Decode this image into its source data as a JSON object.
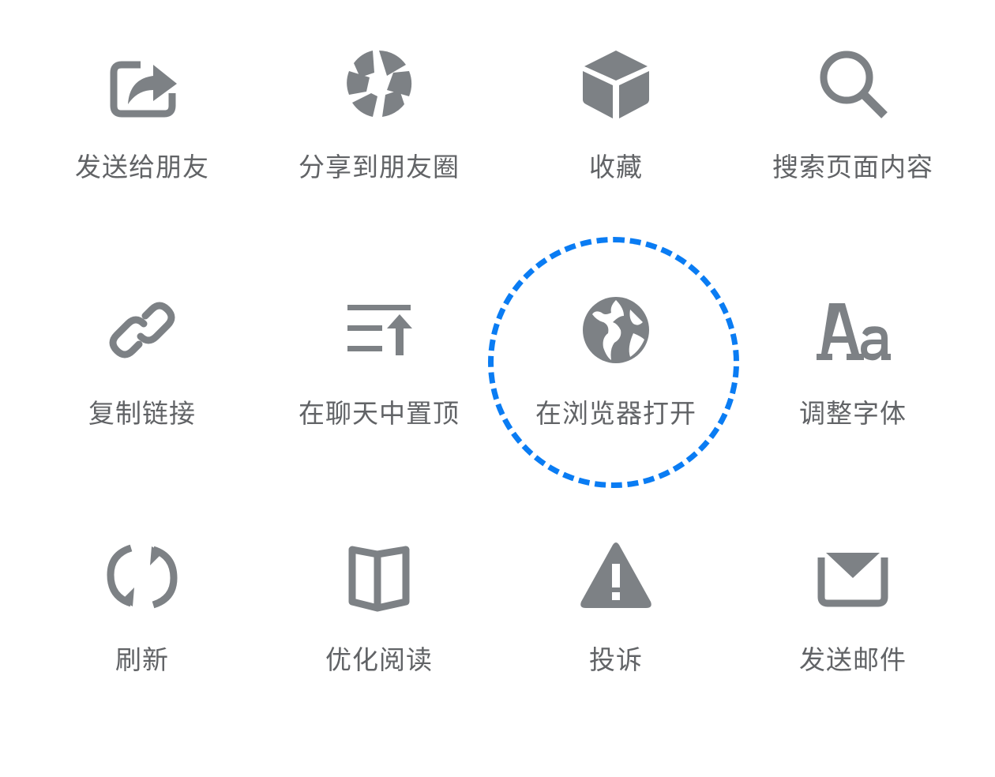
{
  "menu": {
    "items": [
      {
        "label": "发送给朋友",
        "icon": "share-forward-icon"
      },
      {
        "label": "分享到朋友圈",
        "icon": "moments-shutter-icon"
      },
      {
        "label": "收藏",
        "icon": "favorite-cube-icon"
      },
      {
        "label": "搜索页面内容",
        "icon": "search-icon"
      },
      {
        "label": "复制链接",
        "icon": "link-icon"
      },
      {
        "label": "在聊天中置顶",
        "icon": "pin-to-top-icon"
      },
      {
        "label": "在浏览器打开",
        "icon": "globe-icon"
      },
      {
        "label": "调整字体",
        "icon": "font-size-icon"
      },
      {
        "label": "刷新",
        "icon": "refresh-icon"
      },
      {
        "label": "优化阅读",
        "icon": "book-icon"
      },
      {
        "label": "投诉",
        "icon": "warning-icon"
      },
      {
        "label": "发送邮件",
        "icon": "mail-icon"
      }
    ],
    "highlighted_item": "在浏览器打开"
  },
  "colors": {
    "icon": "#7d8185",
    "label": "#616366",
    "highlight": "#0a7cf3",
    "background": "#ffffff"
  }
}
